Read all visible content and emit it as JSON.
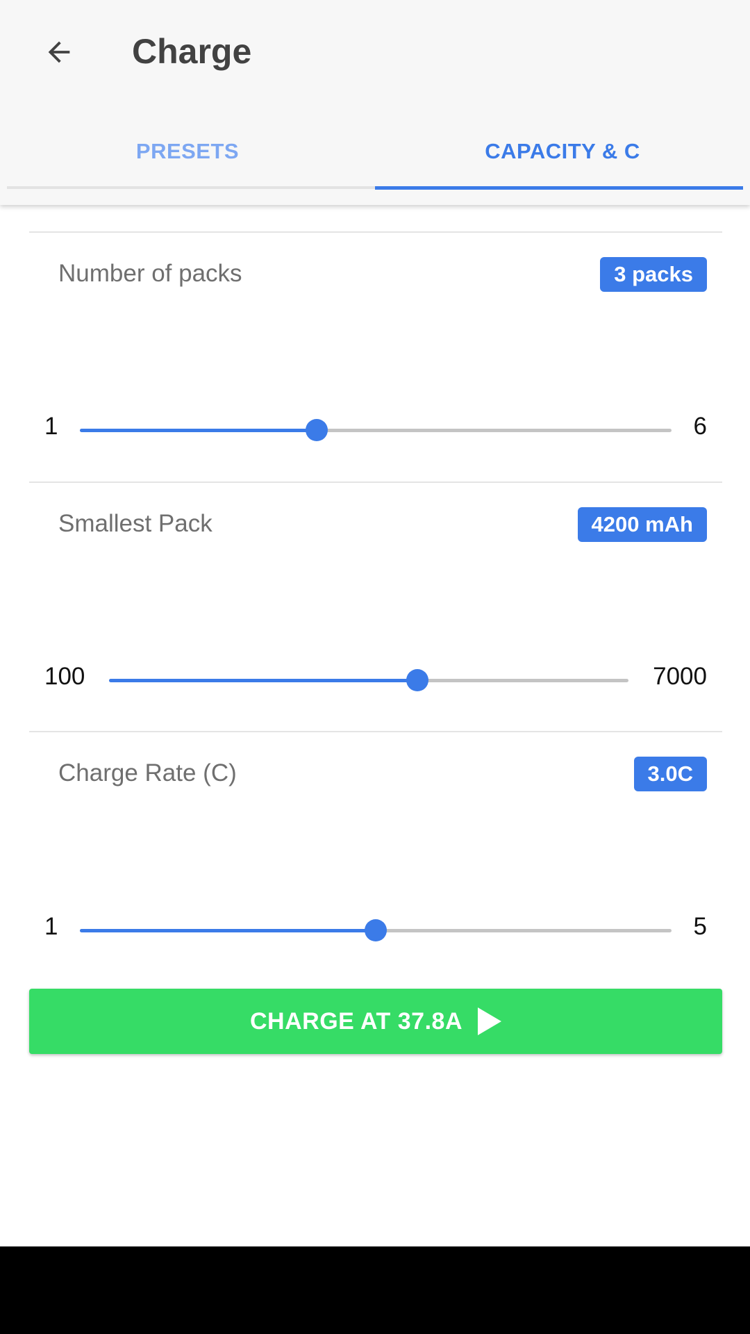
{
  "header": {
    "title": "Charge"
  },
  "tabs": [
    {
      "label": "PRESETS",
      "selected": false
    },
    {
      "label": "CAPACITY & C",
      "selected": true
    }
  ],
  "sections": [
    {
      "label": "Number of packs",
      "badge": "3 packs",
      "min": "1",
      "max": "6",
      "value": 3,
      "range": [
        1,
        6
      ]
    },
    {
      "label": "Smallest Pack",
      "badge": "4200 mAh",
      "min": "100",
      "max": "7000",
      "value": 4200,
      "range": [
        100,
        7000
      ]
    },
    {
      "label": "Charge Rate (C)",
      "badge": "3.0C",
      "min": "1",
      "max": "5",
      "value": 3.0,
      "range": [
        1,
        5
      ]
    }
  ],
  "action": {
    "label": "CHARGE AT 37.8A"
  },
  "colors": {
    "accent": "#3b7be8",
    "accent_light": "#7da7f2",
    "action": "#36dc66",
    "appbar": "#f7f7f7"
  },
  "icons": {
    "back": "arrow-left-icon",
    "play": "play-icon"
  }
}
